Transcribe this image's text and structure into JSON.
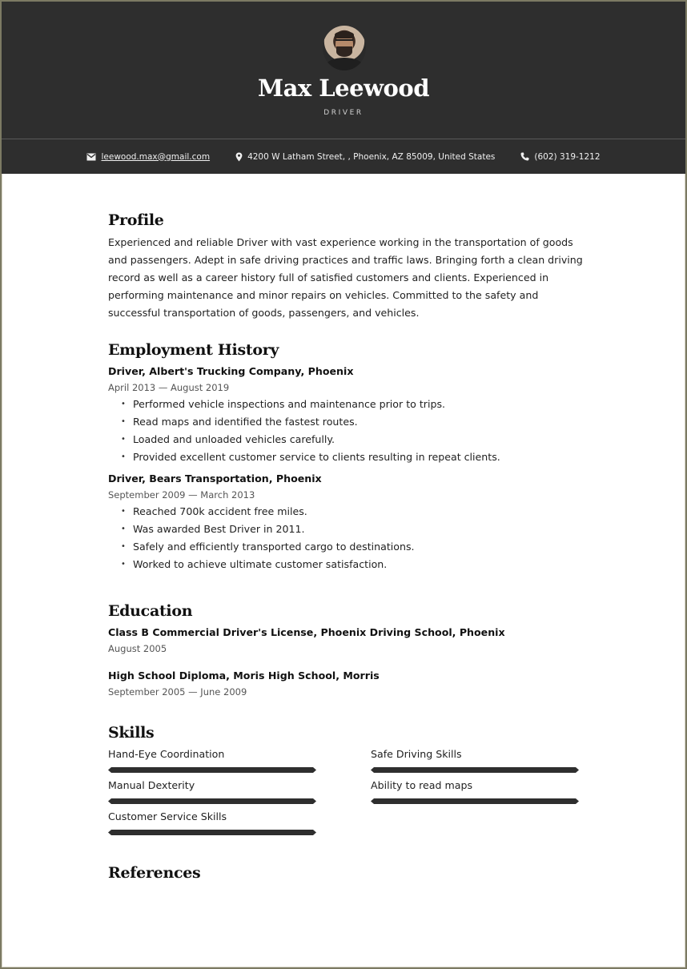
{
  "header": {
    "name": "Max Leewood",
    "title": "DRIVER",
    "avatar_icon": "profile-photo",
    "contact": {
      "email": "leewood.max@gmail.com",
      "email_icon": "envelope-icon",
      "address": "4200 W Latham Street, , Phoenix, AZ 85009, United States",
      "address_icon": "map-pin-icon",
      "phone": "(602) 319-1212",
      "phone_icon": "phone-icon"
    }
  },
  "colors": {
    "header_bg": "#2e2e2e",
    "accent": "#2e2e2e",
    "page_border": "#7c7a63"
  },
  "profile": {
    "heading": "Profile",
    "text": "Experienced and reliable Driver with vast experience working in the transportation of goods and passengers. Adept in safe driving practices and traffic laws. Bringing forth a clean driving record as well as a career history full of satisfied customers and clients. Experienced in performing maintenance and minor repairs on vehicles. Committed to the safety and successful transportation of goods, passengers, and vehicles."
  },
  "employment": {
    "heading": "Employment History",
    "jobs": [
      {
        "title": "Driver, Albert's Trucking Company, Phoenix",
        "dates": "April 2013 — August 2019",
        "bullets": [
          "Performed vehicle inspections and maintenance prior to trips.",
          "Read maps and identified the fastest routes.",
          "Loaded and unloaded vehicles carefully.",
          "Provided excellent customer service to clients resulting in repeat clients."
        ]
      },
      {
        "title": "Driver, Bears Transportation, Phoenix",
        "dates": "September 2009 — March 2013",
        "bullets": [
          "Reached 700k accident free miles.",
          "Was awarded Best Driver in 2011.",
          "Safely and efficiently transported cargo to destinations.",
          "Worked to achieve ultimate customer satisfaction."
        ]
      }
    ]
  },
  "education": {
    "heading": "Education",
    "items": [
      {
        "title": "Class B Commercial Driver's License, Phoenix Driving School, Phoenix",
        "dates": "August 2005"
      },
      {
        "title": "High School Diploma, Moris High School, Morris",
        "dates": "September 2005 — June 2009"
      }
    ]
  },
  "skills": {
    "heading": "Skills",
    "items": [
      {
        "label": "Hand-Eye Coordination",
        "level": 1.0
      },
      {
        "label": "Safe Driving Skills",
        "level": 1.0
      },
      {
        "label": "Manual Dexterity",
        "level": 1.0
      },
      {
        "label": "Ability to read maps",
        "level": 1.0
      },
      {
        "label": "Customer Service Skills",
        "level": 1.0
      }
    ]
  },
  "references": {
    "heading": "References"
  }
}
